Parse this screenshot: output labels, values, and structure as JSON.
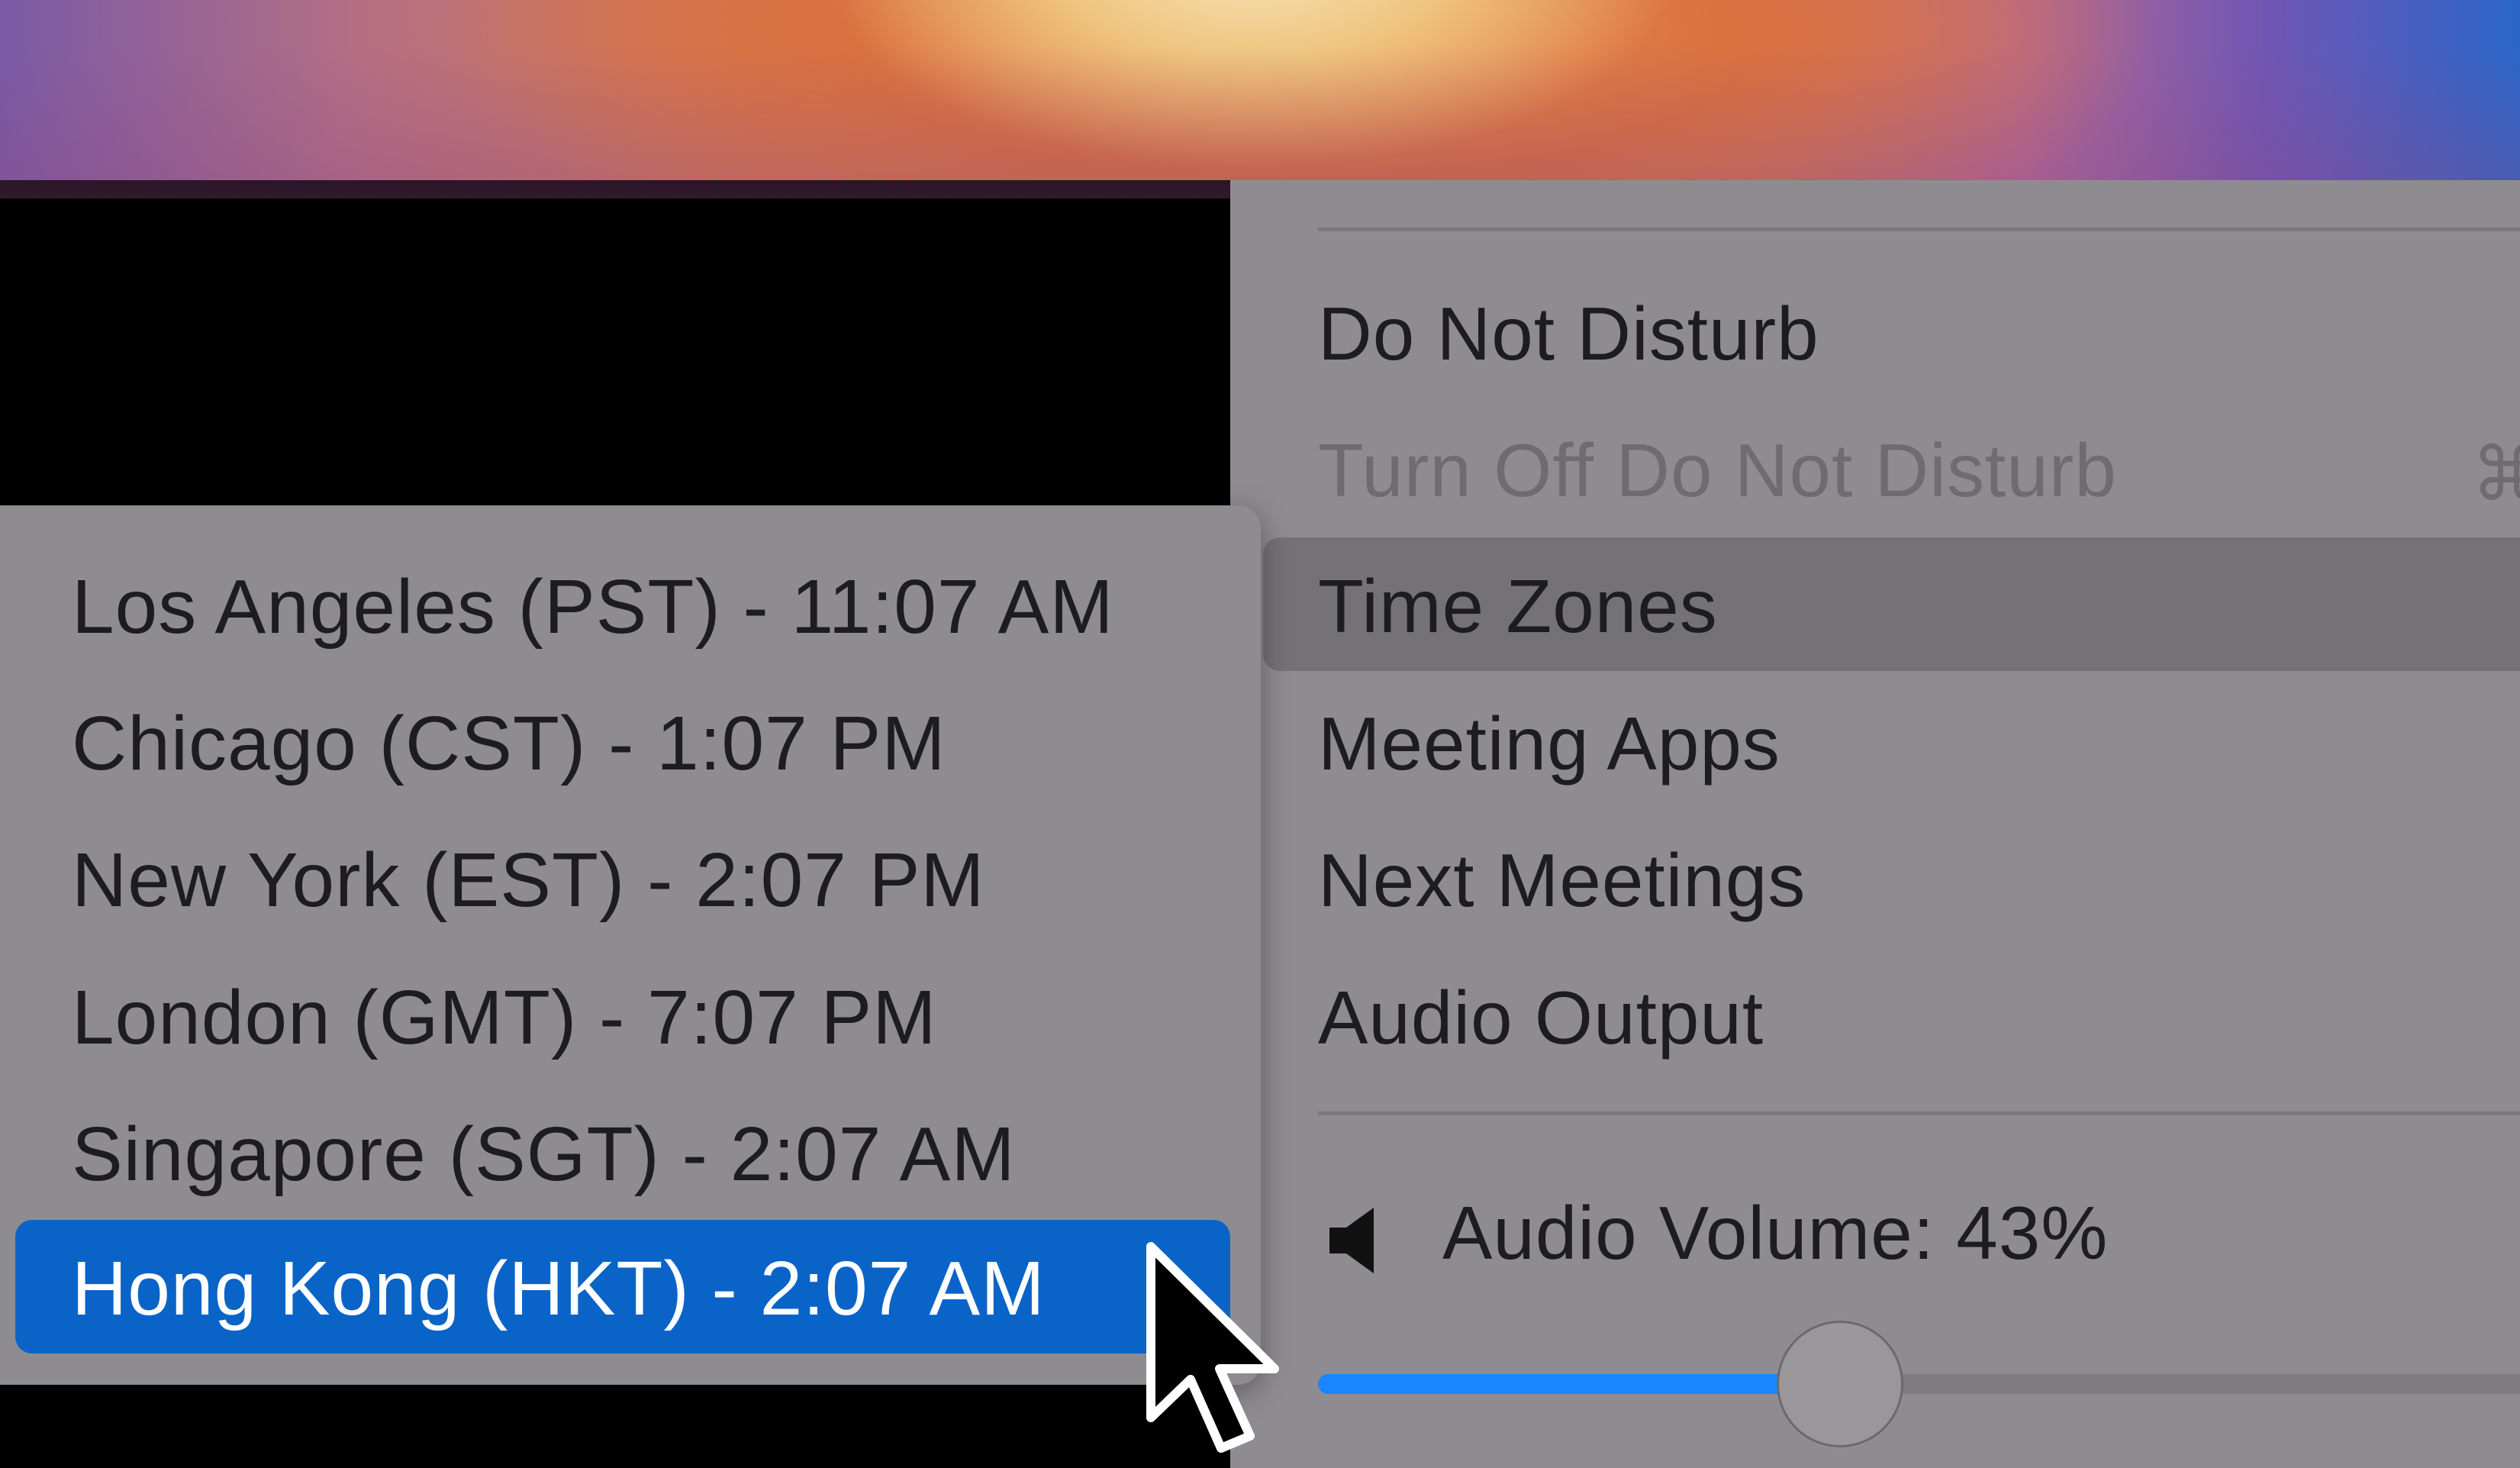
{
  "main_menu": {
    "items": [
      {
        "label": "Do Not Disturb",
        "enabled": true
      },
      {
        "label": "Turn Off Do Not Disturb",
        "enabled": false,
        "shortcut": "⌘"
      },
      {
        "label": "Time Zones",
        "enabled": true,
        "highlighted": true
      },
      {
        "label": "Meeting Apps",
        "enabled": true
      },
      {
        "label": "Next Meetings",
        "enabled": true
      },
      {
        "label": "Audio Output",
        "enabled": true
      }
    ],
    "volume": {
      "label": "Audio Volume: 43%",
      "value": 43,
      "icon": "speaker-icon",
      "accent_color": "#1a85ff"
    }
  },
  "time_zones_submenu": {
    "items": [
      {
        "label": "Los Angeles (PST) - 11:07 AM"
      },
      {
        "label": "Chicago (CST) - 1:07 PM"
      },
      {
        "label": "New York (EST) - 2:07 PM"
      },
      {
        "label": "London (GMT) - 7:07 PM"
      },
      {
        "label": "Singapore (SGT) - 2:07 AM"
      },
      {
        "label": "Hong Kong (HKT) - 2:07 AM",
        "selected": true
      }
    ],
    "selection_color": "#0a64c8"
  }
}
